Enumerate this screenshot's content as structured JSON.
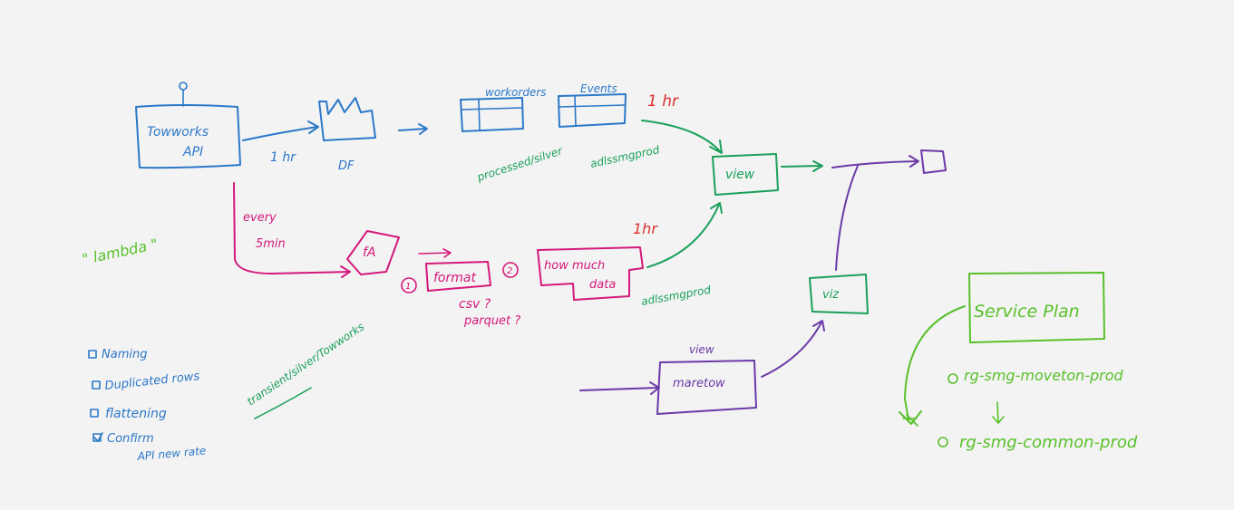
{
  "colors": {
    "blue": "#2b78c9",
    "green": "#1aa05a",
    "magenta": "#d4197a",
    "red": "#d83030",
    "purple": "#6a3aa7",
    "lime": "#58c02a",
    "background": "#f3f3f3"
  },
  "labels": {
    "towworks_api_line1": "Towworks",
    "towworks_api_line2": "API",
    "df_label": "DF",
    "interval_1hr_blue": "1 hr",
    "workorders": "workorders",
    "events": "Events",
    "processed_silver": "processed/silver",
    "adls_smg_prod_top": "adlssmgprod",
    "interval_1hr_red_top": "1 hr",
    "view_box": "view",
    "every": "every",
    "five_min": "5min",
    "lambda": "\" lambda \"",
    "fa": "fA",
    "step_1": "1",
    "format": "format",
    "step_2": "2",
    "csv_q": "csv ?",
    "parquet_q": "parquet ?",
    "how_much_line1": "how much",
    "how_much_line2": "data",
    "interval_1hr_red_mid": "1hr",
    "adls_smg_prod_mid": "adlssmgprod",
    "viz_box": "viz",
    "transient_path": "transient/silver/Towworks",
    "view_small": "view",
    "maretow": "maretow",
    "service_plan": "Service Plan",
    "rg_moveton": "rg-smg-moveton-prod",
    "rg_common": "rg-smg-common-prod"
  },
  "checklist": [
    "Naming",
    "Duplicated rows",
    "flattening",
    "Confirm"
  ],
  "checklist_extra": "API new rate"
}
